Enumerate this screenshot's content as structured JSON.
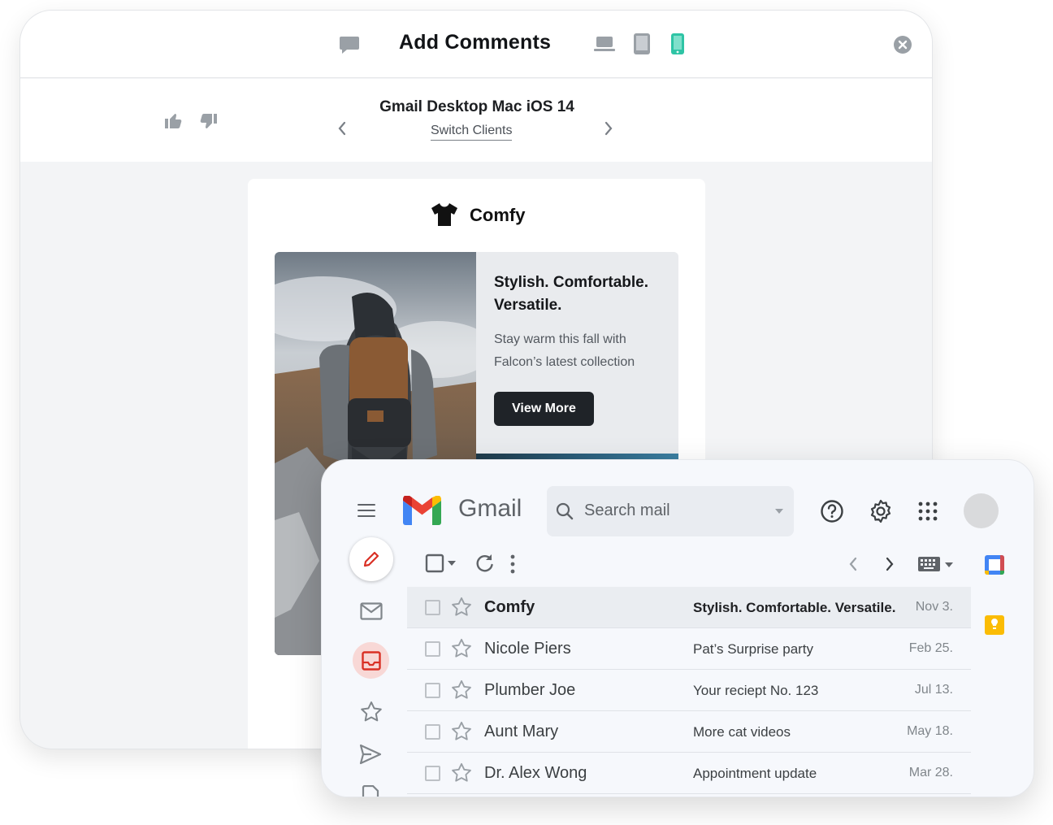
{
  "comments_panel": {
    "title": "Add Comments",
    "client_name": "Gmail Desktop Mac iOS 14",
    "switch_clients": "Switch Clients"
  },
  "email_preview": {
    "brand": "Comfy",
    "headline": "Stylish. Comfortable. Versatile.",
    "body": "Stay warm this fall with Falcon’s latest collection",
    "cta": "View More"
  },
  "gmail": {
    "app_name": "Gmail",
    "search_placeholder": "Search mail",
    "emails": [
      {
        "sender": "Comfy",
        "subject": "Stylish. Comfortable. Versatile.",
        "date": "Nov 3.",
        "unread": true
      },
      {
        "sender": "Nicole Piers",
        "subject": "Pat’s Surprise party",
        "date": "Feb 25.",
        "unread": false
      },
      {
        "sender": "Plumber Joe",
        "subject": "Your reciept No. 123",
        "date": "Jul 13.",
        "unread": false
      },
      {
        "sender": "Aunt Mary",
        "subject": "More cat videos",
        "date": "May 18.",
        "unread": false
      },
      {
        "sender": "Dr. Alex Wong",
        "subject": "Appointment update",
        "date": "Mar 28.",
        "unread": false
      }
    ]
  },
  "colors": {
    "active_device": "#2ec4a5",
    "icon_gray": "#9aa0a6",
    "cta_bg": "#1f2328",
    "gmail_red": "#d93025"
  }
}
